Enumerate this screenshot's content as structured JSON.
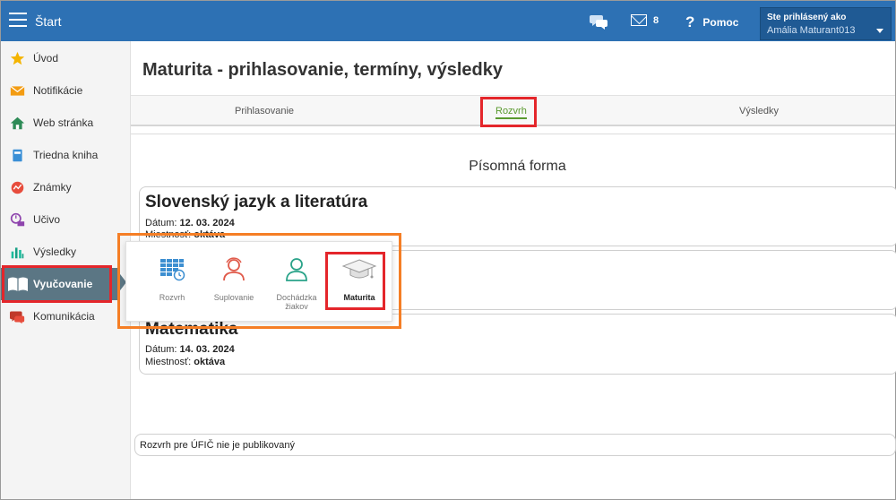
{
  "topbar": {
    "title": "Štart",
    "mail_count": "8",
    "help_label": "Pomoc",
    "user_label": "Ste prihlásený ako",
    "user_name": "Amália Maturant013"
  },
  "sidebar": {
    "items": [
      {
        "label": "Úvod",
        "icon": "star-icon"
      },
      {
        "label": "Notifikácie",
        "icon": "envelope-icon"
      },
      {
        "label": "Web stránka",
        "icon": "home-icon"
      },
      {
        "label": "Triedna kniha",
        "icon": "book-icon"
      },
      {
        "label": "Známky",
        "icon": "grades-icon"
      },
      {
        "label": "Učivo",
        "icon": "curriculum-icon"
      },
      {
        "label": "Výsledky",
        "icon": "bar-chart-icon"
      },
      {
        "label": "Vyučovanie",
        "icon": "open-book-icon"
      },
      {
        "label": "Komunikácia",
        "icon": "chat-icon"
      }
    ]
  },
  "main": {
    "title": "Maturita - prihlasovanie, termíny, výsledky",
    "tabs": [
      "Prihlasovanie",
      "Rozvrh",
      "Výsledky"
    ],
    "active_tab": "Rozvrh",
    "section_title": "Písomná forma",
    "cards": [
      {
        "title": "Slovenský jazyk a literatúra",
        "date_label": "Dátum:",
        "date": "12. 03. 2024",
        "room_label": "Miestnosť:",
        "room": "oktáva"
      },
      {
        "title": "Matematika",
        "date_label": "Dátum:",
        "date": "14. 03. 2024",
        "room_label": "Miestnosť:",
        "room": "oktáva"
      }
    ],
    "footer_note": "Rozvrh pre ÚFIČ nie je publikovaný"
  },
  "popup": {
    "items": [
      {
        "label": "Rozvrh",
        "icon": "timetable-icon"
      },
      {
        "label": "Suplovanie",
        "icon": "substitute-person-icon"
      },
      {
        "label": "Dochádzka žiakov",
        "icon": "attendance-person-icon"
      },
      {
        "label": "Maturita",
        "icon": "graduation-cap-icon"
      }
    ]
  },
  "colors": {
    "topbar": "#2d71b4",
    "sidebar_active": "#5b7684",
    "tab_active": "#5a9a2f",
    "highlight_red": "#e4262b",
    "highlight_orange": "#f57e25"
  }
}
